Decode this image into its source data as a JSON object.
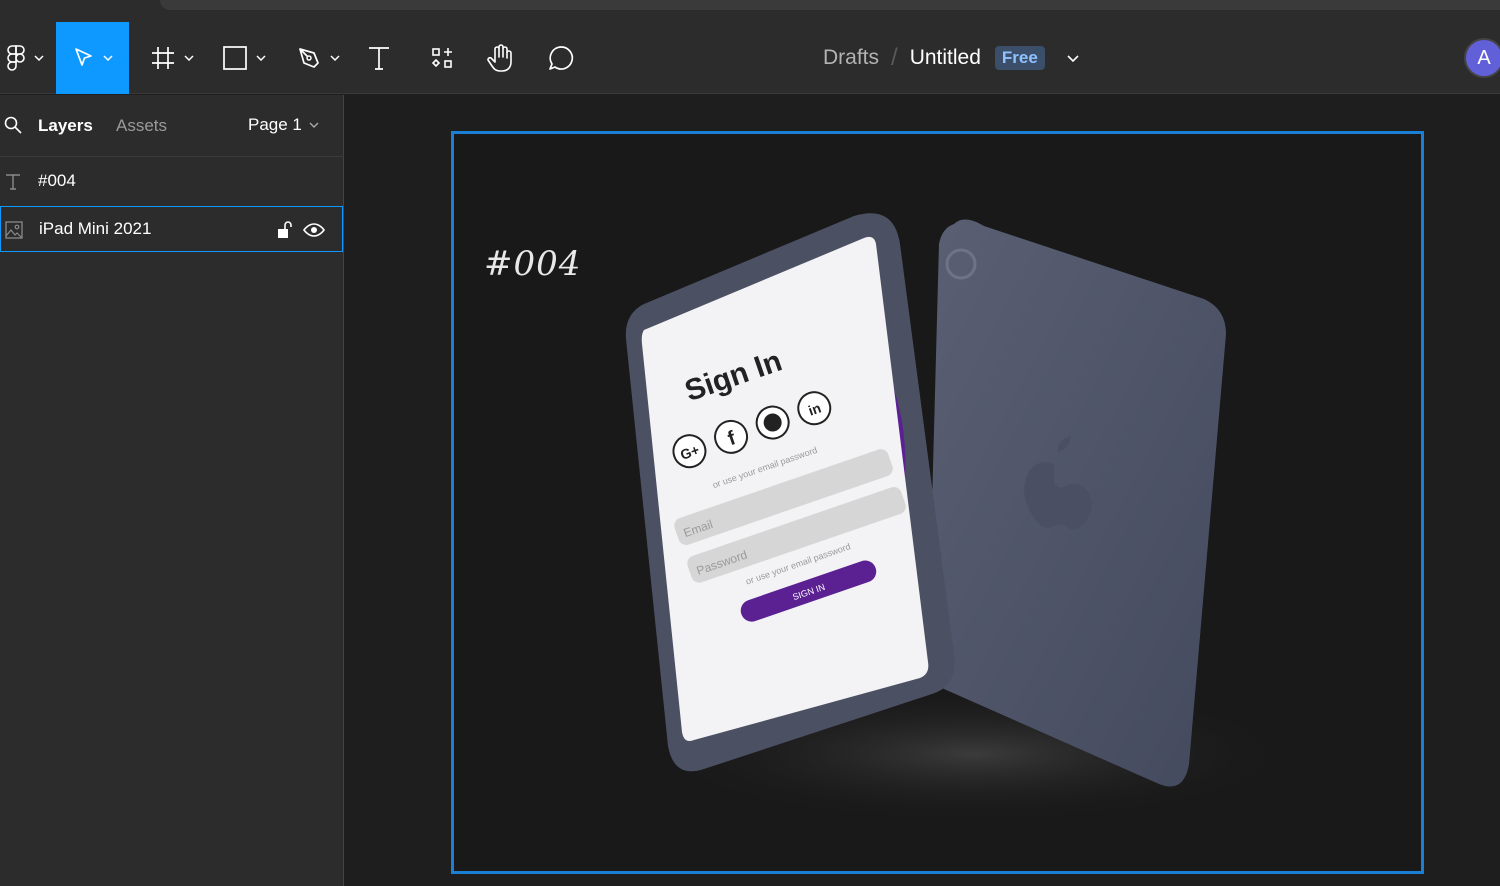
{
  "toolbar": {
    "tools": [
      {
        "name": "main-menu",
        "icon": "figma-logo-icon"
      },
      {
        "name": "move",
        "icon": "pointer-icon",
        "active": true
      },
      {
        "name": "frame",
        "icon": "frame-hash-icon"
      },
      {
        "name": "shape",
        "icon": "rectangle-icon"
      },
      {
        "name": "pen",
        "icon": "pen-icon"
      },
      {
        "name": "text",
        "icon": "text-icon"
      },
      {
        "name": "resources",
        "icon": "components-icon"
      },
      {
        "name": "hand",
        "icon": "hand-icon"
      },
      {
        "name": "comment",
        "icon": "comment-icon"
      }
    ],
    "active_color": "#0d99ff"
  },
  "header": {
    "breadcrumb_parent": "Drafts",
    "breadcrumb_separator": "/",
    "file_title": "Untitled",
    "plan_badge": "Free",
    "avatar_initial": "A"
  },
  "sidebar": {
    "tabs": {
      "layers": "Layers",
      "assets": "Assets"
    },
    "page_selector": "Page 1",
    "layers": [
      {
        "label": "#004",
        "icon": "text-layer-icon"
      },
      {
        "label": "iPad Mini 2021",
        "icon": "image-layer-icon",
        "selected": true
      }
    ]
  },
  "canvas": {
    "frame_label": "#004",
    "mockup": {
      "title": "Sign In",
      "social_icons": [
        "google-plus-icon",
        "facebook-icon",
        "github-icon",
        "linkedin-icon"
      ],
      "hint_top": "or use your email password",
      "email_placeholder": "Email",
      "password_placeholder": "Password",
      "hint_bottom": "or use your email password",
      "button_label": "SIGN IN",
      "accent": "#5b2193"
    }
  }
}
